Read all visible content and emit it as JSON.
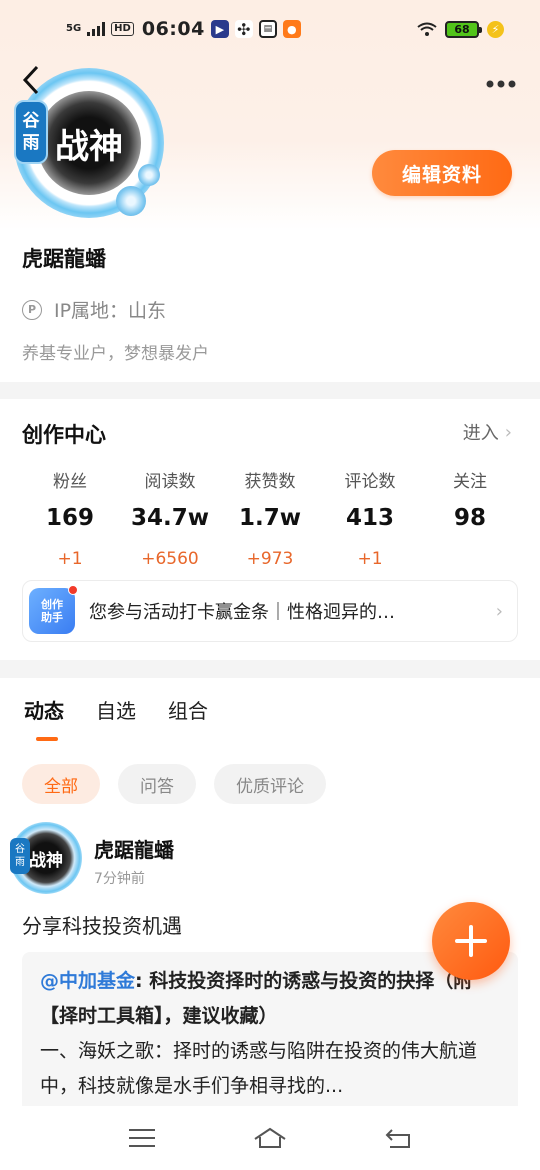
{
  "status_bar": {
    "network": "5G",
    "hd": "HD",
    "time": "06:04",
    "battery": "68"
  },
  "profile": {
    "avatar_text": "战神",
    "badge_top": "谷",
    "badge_bottom": "雨",
    "edit_label": "编辑资料",
    "username": "虎踞龍蟠",
    "ip_icon": "P",
    "ip_label": "IP属地：山东",
    "bio": "养基专业户，梦想暴发户"
  },
  "creation_center": {
    "title": "创作中心",
    "enter_label": "进入",
    "stats": [
      {
        "label": "粉丝",
        "value": "169",
        "delta": "+1"
      },
      {
        "label": "阅读数",
        "value": "34.7w",
        "delta": "+6560"
      },
      {
        "label": "获赞数",
        "value": "1.7w",
        "delta": "+973"
      },
      {
        "label": "评论数",
        "value": "413",
        "delta": "+1"
      },
      {
        "label": "关注",
        "value": "98",
        "delta": ""
      }
    ],
    "promo_logo_top": "创作",
    "promo_logo_bottom": "助手",
    "promo_text": "您参与活动打卡赢金条｜性格迥异的…"
  },
  "feed": {
    "tabs": [
      "动态",
      "自选",
      "组合"
    ],
    "chips": [
      "全部",
      "问答",
      "优质评论"
    ],
    "post": {
      "avatar_text": "战神",
      "badge_top": "谷",
      "badge_bottom": "雨",
      "author": "虎踞龍蟠",
      "time": "7分钟前",
      "text": "分享科技投资机遇",
      "quote_at": "@中加基金",
      "quote_title": ": 科技投资择时的诱惑与投资的抉择（附【择时工具箱】，建议收藏）",
      "quote_body": "一、海妖之歌：择时的诱惑与陷阱在投资的伟大航道中，科技就像是水手们争相寻找的..."
    }
  },
  "colors": {
    "accent": "#ff6a14",
    "link": "#2f7ad8",
    "delta": "#e8672b"
  }
}
